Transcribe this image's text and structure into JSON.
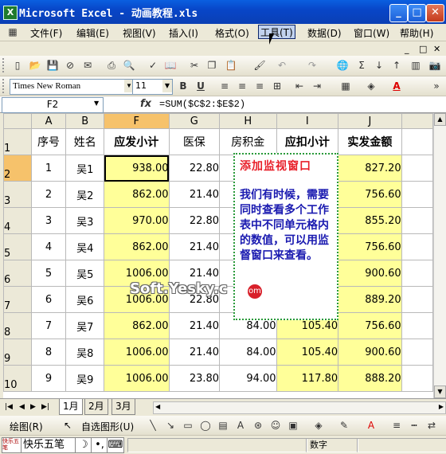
{
  "window": {
    "title": "Microsoft Excel - 动画教程.xls",
    "app_icon": "excel-icon",
    "min": "_",
    "max": "□",
    "close": "✕"
  },
  "menu": [
    {
      "label": "文件(F)"
    },
    {
      "label": "编辑(E)"
    },
    {
      "label": "视图(V)"
    },
    {
      "label": "插入(I)"
    },
    {
      "label": "格式(O)"
    },
    {
      "label": "工具(T)"
    },
    {
      "label": "数据(D)"
    },
    {
      "label": "窗口(W)"
    },
    {
      "label": "帮助(H)"
    }
  ],
  "menu_active": "工具(T)",
  "doc_controls": [
    "_",
    "□",
    "✕"
  ],
  "format_toolbar": {
    "font": "Times New Roman",
    "size": "11",
    "bold": "B",
    "underline": "U",
    "font_color_sample": "A"
  },
  "formula_bar": {
    "name_box": "F2",
    "fx": "fx",
    "formula": "=SUM($C$2:$E$2)"
  },
  "columns": [
    "A",
    "B",
    "F",
    "G",
    "H",
    "I",
    "J"
  ],
  "selected_column": "F",
  "selected_row": "2",
  "header_row": {
    "row": "1",
    "cells": [
      "序号",
      "姓名",
      "应发小计",
      "医保",
      "房积金",
      "应扣小计",
      "实发金额"
    ]
  },
  "rows": [
    {
      "row": "2",
      "cells": [
        "1",
        "吴1",
        "938.00",
        "22.80",
        "",
        "",
        "827.20"
      ]
    },
    {
      "row": "3",
      "cells": [
        "2",
        "吴2",
        "862.00",
        "21.40",
        "",
        "",
        "756.60"
      ]
    },
    {
      "row": "4",
      "cells": [
        "3",
        "吴3",
        "970.00",
        "22.80",
        "",
        "",
        "855.20"
      ]
    },
    {
      "row": "5",
      "cells": [
        "4",
        "吴4",
        "862.00",
        "21.40",
        "",
        "",
        "756.60"
      ]
    },
    {
      "row": "6",
      "cells": [
        "5",
        "吴5",
        "1006.00",
        "21.40",
        "",
        "",
        "900.60"
      ]
    },
    {
      "row": "7",
      "cells": [
        "6",
        "吴6",
        "1006.00",
        "22.80",
        "",
        "",
        "889.20"
      ]
    },
    {
      "row": "8",
      "cells": [
        "7",
        "吴7",
        "862.00",
        "21.40",
        "84.00",
        "105.40",
        "756.60"
      ]
    },
    {
      "row": "9",
      "cells": [
        "8",
        "吴8",
        "1006.00",
        "21.40",
        "84.00",
        "105.40",
        "900.60"
      ]
    },
    {
      "row": "10",
      "cells": [
        "9",
        "吴9",
        "1006.00",
        "23.80",
        "94.00",
        "117.80",
        "888.20"
      ]
    }
  ],
  "sheet_tabs": [
    "1月",
    "2月",
    "3月"
  ],
  "active_tab": "1月",
  "note": {
    "title": "添加监视窗口",
    "body": "我们有时候，需要同时查看多个工作表中不同单元格内的数值，可以用监督窗口来查看。"
  },
  "watermark": "Soft.Yesky.c",
  "watermark_seal": "om",
  "drawing_toolbar": {
    "draw": "绘图(R)",
    "autoshapes": "自选图形(U)"
  },
  "status": {
    "ime": "快乐五笔",
    "ime_logo": "快乐五笔",
    "mode": "数字"
  },
  "colors": {
    "selected_header": "#f6c26b",
    "fill_yellow": "#ffff99",
    "note_title": "#e8202a",
    "note_body": "#1a1ab0"
  }
}
